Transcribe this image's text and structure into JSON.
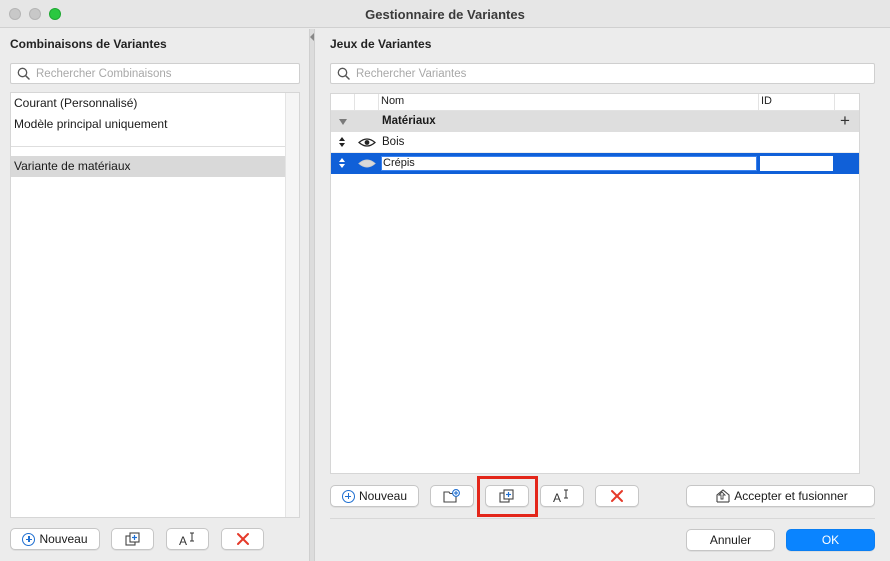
{
  "window": {
    "title": "Gestionnaire de Variantes"
  },
  "left": {
    "title": "Combinaisons de Variantes",
    "search_placeholder": "Rechercher Combinaisons",
    "items": [
      {
        "label": "Courant (Personnalisé)"
      },
      {
        "label": "Modèle principal uniquement"
      },
      {
        "label": "Variante de matériaux"
      }
    ],
    "new_label": "Nouveau"
  },
  "right": {
    "title": "Jeux de Variantes",
    "search_placeholder": "Rechercher Variantes",
    "columns": {
      "name": "Nom",
      "id": "ID"
    },
    "group": {
      "label": "Matériaux",
      "add_glyph": "+"
    },
    "rows": [
      {
        "label": "Bois",
        "visible": true
      },
      {
        "label": "Crépis",
        "selected": true,
        "editing": true
      }
    ],
    "new_label": "Nouveau",
    "accept_label": "Accepter et fusionner"
  },
  "footer": {
    "cancel_label": "Annuler",
    "ok_label": "OK"
  },
  "colors": {
    "accent": "#0a84ff",
    "selection": "#1060d8",
    "highlight": "#e3261a",
    "delete": "#e53a2a"
  },
  "icons": [
    "search-icon",
    "plus-circle-icon",
    "duplicate-icon",
    "rename-icon",
    "delete-icon",
    "new-folder-icon",
    "merge-icon",
    "eye-icon",
    "sort-arrows-icon",
    "disclosure-triangle-icon"
  ]
}
